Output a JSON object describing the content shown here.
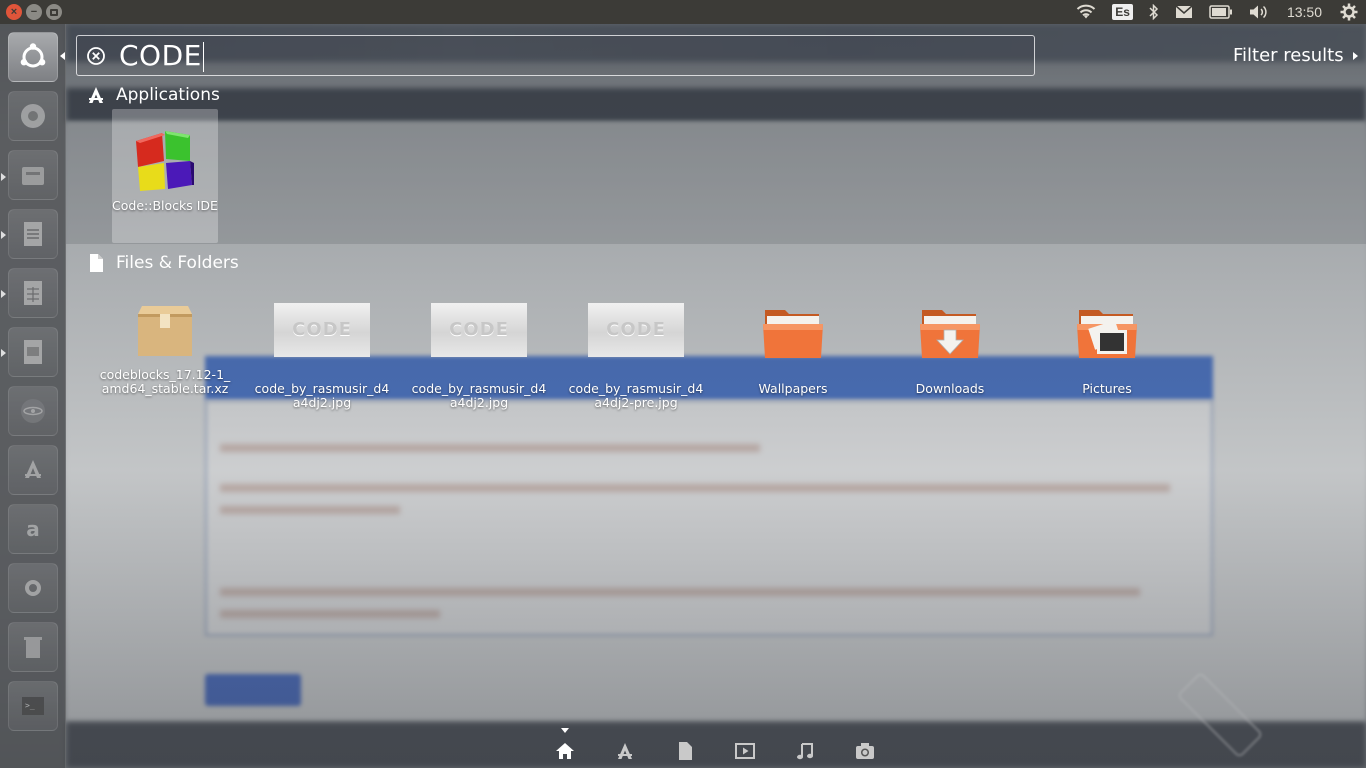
{
  "top_panel": {
    "window_controls": [
      "close-icon",
      "minimize-icon",
      "maximize-icon"
    ],
    "indicators": {
      "keyboard_layout": "Es",
      "clock": "13:50"
    }
  },
  "search": {
    "query": "CODE",
    "filter_label": "Filter results"
  },
  "categories": {
    "applications": {
      "title": "Applications",
      "items": [
        {
          "label": "Code::Blocks IDE",
          "icon": "codeblocks-icon"
        }
      ]
    },
    "files": {
      "title": "Files & Folders",
      "items": [
        {
          "label": "codeblocks_17.12-1_amd64_stable.tar.xz",
          "icon": "package-icon"
        },
        {
          "label": "code_by_rasmusir_d4a4dj2.jpg",
          "icon": "image-thumbnail",
          "thumb_text": "CODE"
        },
        {
          "label": "code_by_rasmusir_d4a4dj2.jpg",
          "icon": "image-thumbnail",
          "thumb_text": "CODE"
        },
        {
          "label": "code_by_rasmusir_d4a4dj2-pre.jpg",
          "icon": "image-thumbnail",
          "thumb_text": "CODE"
        },
        {
          "label": "Wallpapers",
          "icon": "folder-icon"
        },
        {
          "label": "Downloads",
          "icon": "folder-downloads-icon"
        },
        {
          "label": "Pictures",
          "icon": "folder-pictures-icon"
        }
      ]
    }
  },
  "lenses": [
    "home-icon",
    "applications-icon",
    "files-icon",
    "video-icon",
    "music-icon",
    "photos-icon"
  ],
  "colors": {
    "panel": "#3c3b37",
    "close_button": "#e0553a",
    "folder_orange": "#f0743a"
  }
}
